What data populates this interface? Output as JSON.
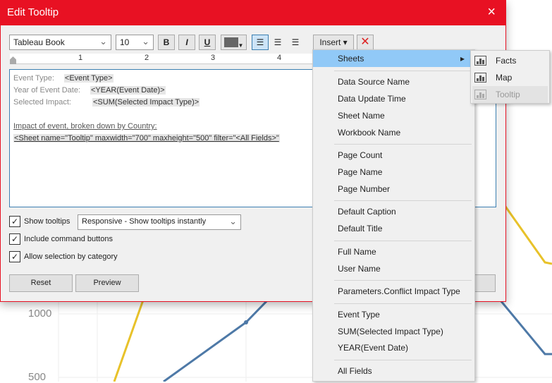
{
  "background_chart": {
    "y_ticks": [
      "1000",
      "500"
    ],
    "colors": {
      "yellow": "#e8c22a",
      "blue": "#4e79a7"
    }
  },
  "dialog": {
    "title": "Edit Tooltip",
    "close_icon": "×"
  },
  "toolbar": {
    "font": "Tableau Book",
    "size": "10",
    "bold": "B",
    "italic": "I",
    "underline": "U",
    "insert": "Insert ▾",
    "clear_icon": "✕"
  },
  "ruler": {
    "marks": [
      "1",
      "2",
      "3",
      "4"
    ]
  },
  "editor": {
    "lines": [
      {
        "label": "Event Type:",
        "field": "<Event Type>"
      },
      {
        "label": "Year of Event Date:",
        "field": "<YEAR(Event Date)>"
      },
      {
        "label": "Selected Impact:",
        "field": "<SUM(Selected Impact Type)>"
      }
    ],
    "heading": "Impact of event, broken down by Country:",
    "sheet_tag": "<Sheet name=\"Tooltip\" maxwidth=\"700\" maxheight=\"500\" filter=\"<All Fields>\""
  },
  "options": {
    "show_tooltips": "Show tooltips",
    "tooltip_mode": "Responsive - Show tooltips instantly",
    "include_buttons": "Include command buttons",
    "allow_selection": "Allow selection by category",
    "check": "✓"
  },
  "buttons": {
    "reset": "Reset",
    "preview": "Preview"
  },
  "menu": {
    "items": [
      "Sheets",
      "Data Source Name",
      "Data Update Time",
      "Sheet Name",
      "Workbook Name",
      "Page Count",
      "Page Name",
      "Page Number",
      "Default Caption",
      "Default Title",
      "Full Name",
      "User Name",
      "Parameters.Conflict Impact Type",
      "Event Type",
      "SUM(Selected Impact Type)",
      "YEAR(Event Date)",
      "All Fields"
    ],
    "arrow": "▸"
  },
  "submenu": {
    "items": [
      "Facts",
      "Map",
      "Tooltip"
    ]
  }
}
